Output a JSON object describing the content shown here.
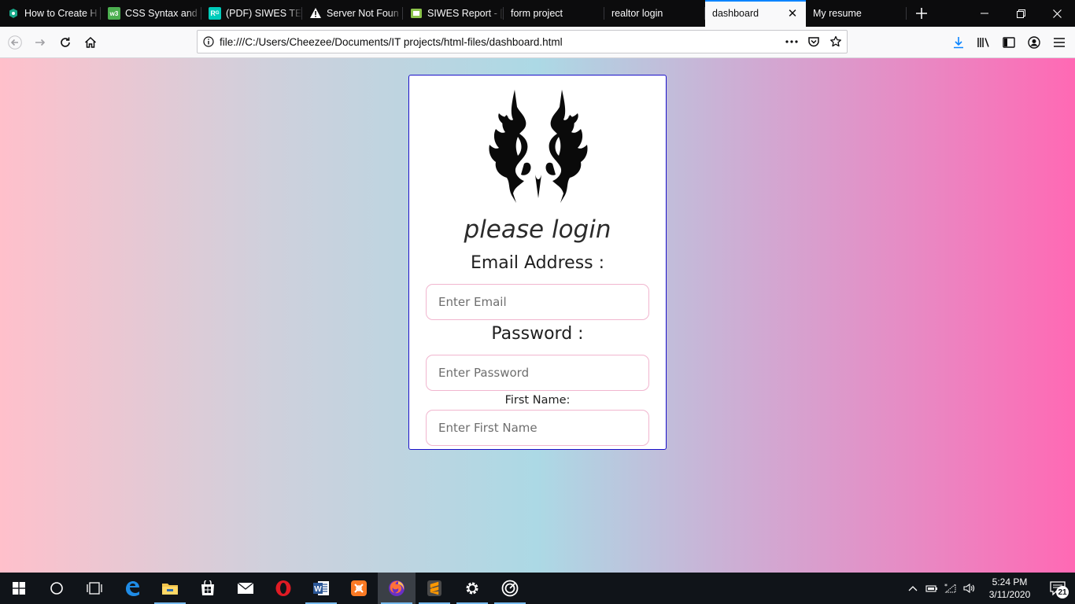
{
  "browser": {
    "tabs": [
      {
        "title": "How to Create H",
        "icon": "shield-favicon-icon",
        "color": "#19a889"
      },
      {
        "title": "CSS Syntax and S",
        "icon": "w3schools-favicon-icon",
        "color": "#4caf50"
      },
      {
        "title": "(PDF) SIWES TEC",
        "icon": "researchgate-favicon-icon",
        "color": "#00ccbb"
      },
      {
        "title": "Server Not Foun",
        "icon": "warning-favicon-icon",
        "color": "#ffffff"
      },
      {
        "title": "SIWES Report - [",
        "icon": "docs-favicon-icon",
        "color": "#8bc34a"
      },
      {
        "title": "form project"
      },
      {
        "title": "realtor login"
      },
      {
        "title": "dashboard",
        "active": true
      },
      {
        "title": "My resume"
      }
    ],
    "url": "file:///C:/Users/Cheezee/Documents/IT projects/html-files/dashboard.html",
    "accent_color": "#0a84ff"
  },
  "page": {
    "heading": "please login",
    "email_label": "Email Address :",
    "email_placeholder": "Enter Email",
    "password_label": "Password :",
    "password_placeholder": "Enter Password",
    "firstname_label": "First Name:",
    "firstname_placeholder": "Enter First Name",
    "card_border_color": "#1a10c8",
    "input_border_color": "#f1b6cf",
    "gradient_colors": [
      "#ffc0cb",
      "#acd9e5",
      "#ff69b4"
    ]
  },
  "taskbar": {
    "time": "5:24 PM",
    "date": "3/11/2020",
    "notification_count": "21"
  }
}
